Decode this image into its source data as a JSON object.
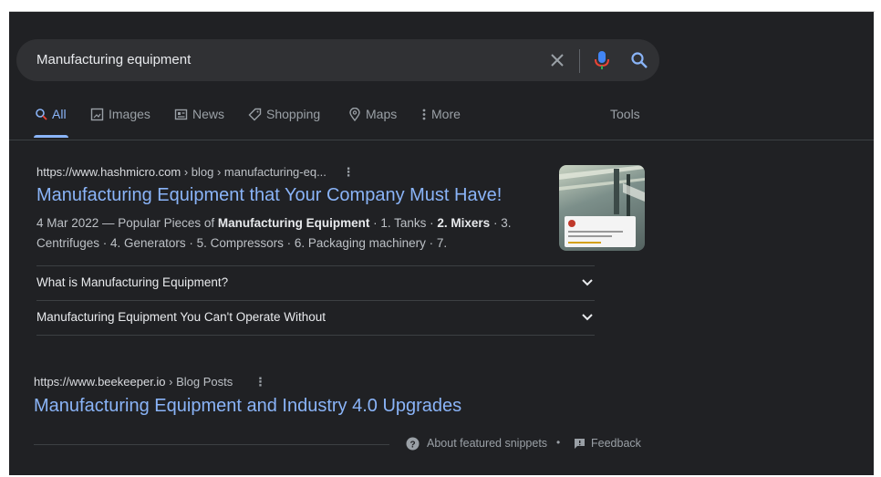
{
  "search": {
    "query": "Manufacturing equipment"
  },
  "tabs": [
    {
      "label": "All",
      "icon": "search-icon",
      "active": true
    },
    {
      "label": "Images",
      "icon": "image-icon"
    },
    {
      "label": "News",
      "icon": "news-icon"
    },
    {
      "label": "Shopping",
      "icon": "tag-icon"
    },
    {
      "label": "Maps",
      "icon": "map-pin-icon"
    },
    {
      "label": "More",
      "icon": "more-vert-icon"
    }
  ],
  "tools_label": "Tools",
  "results": [
    {
      "url": "https://www.hashmicro.com",
      "path": " › blog › manufacturing-eq...",
      "title": "Manufacturing Equipment that Your Company Must Have!",
      "date": "4 Mar 2022",
      "snippet_pre": " — Popular Pieces of ",
      "snippet_bold": "Manufacturing Equipment",
      "snippet_mid": " · 1. Tanks · ",
      "snippet_bold2": "2. Mixers",
      "snippet_post": " · 3. Centrifuges · 4. Generators · 5. Compressors · 6. Packaging machinery · 7.",
      "faqs": [
        "What is Manufacturing Equipment?",
        "Manufacturing Equipment You Can't Operate Without"
      ]
    },
    {
      "url": "https://www.beekeeper.io",
      "path": " › Blog Posts",
      "title": "Manufacturing Equipment and Industry 4.0 Upgrades"
    }
  ],
  "footer": {
    "about": "About featured snippets",
    "separator": "•",
    "feedback": "Feedback"
  },
  "colors": {
    "background": "#202124",
    "search_bar": "#303134",
    "link": "#8ab4f8",
    "text_secondary": "#bdc1c6"
  }
}
